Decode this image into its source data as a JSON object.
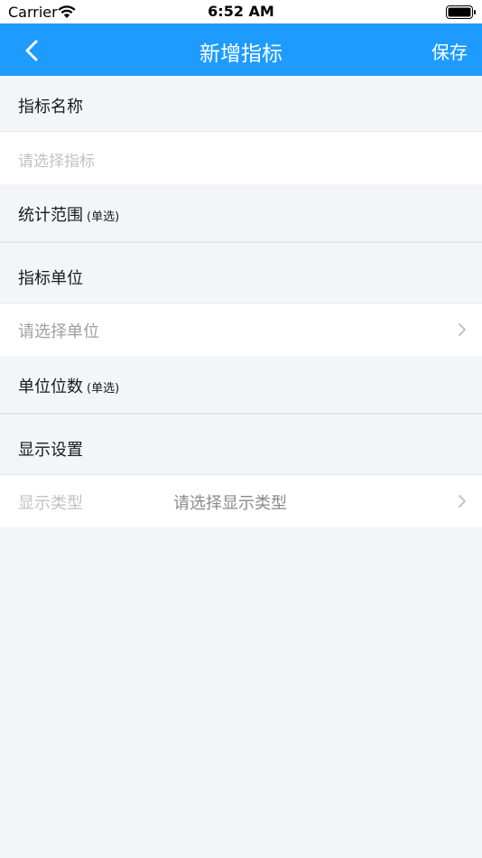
{
  "status_bar": {
    "carrier": "Carrier",
    "time": "6:52 AM"
  },
  "nav": {
    "title": "新增指标",
    "save_label": "保存",
    "color": "#1e9bff"
  },
  "sections": {
    "indicator_name": {
      "label": "指标名称",
      "input_placeholder": "请选择指标"
    },
    "stat_range": {
      "label": "统计范围",
      "hint": "(单选)"
    },
    "indicator_unit": {
      "label": "指标单位",
      "select_placeholder": "请选择单位"
    },
    "unit_digits": {
      "label": "单位位数",
      "hint": "(单选)"
    },
    "display_settings": {
      "label": "显示设置",
      "type_label": "显示类型",
      "type_placeholder": "请选择显示类型"
    }
  }
}
